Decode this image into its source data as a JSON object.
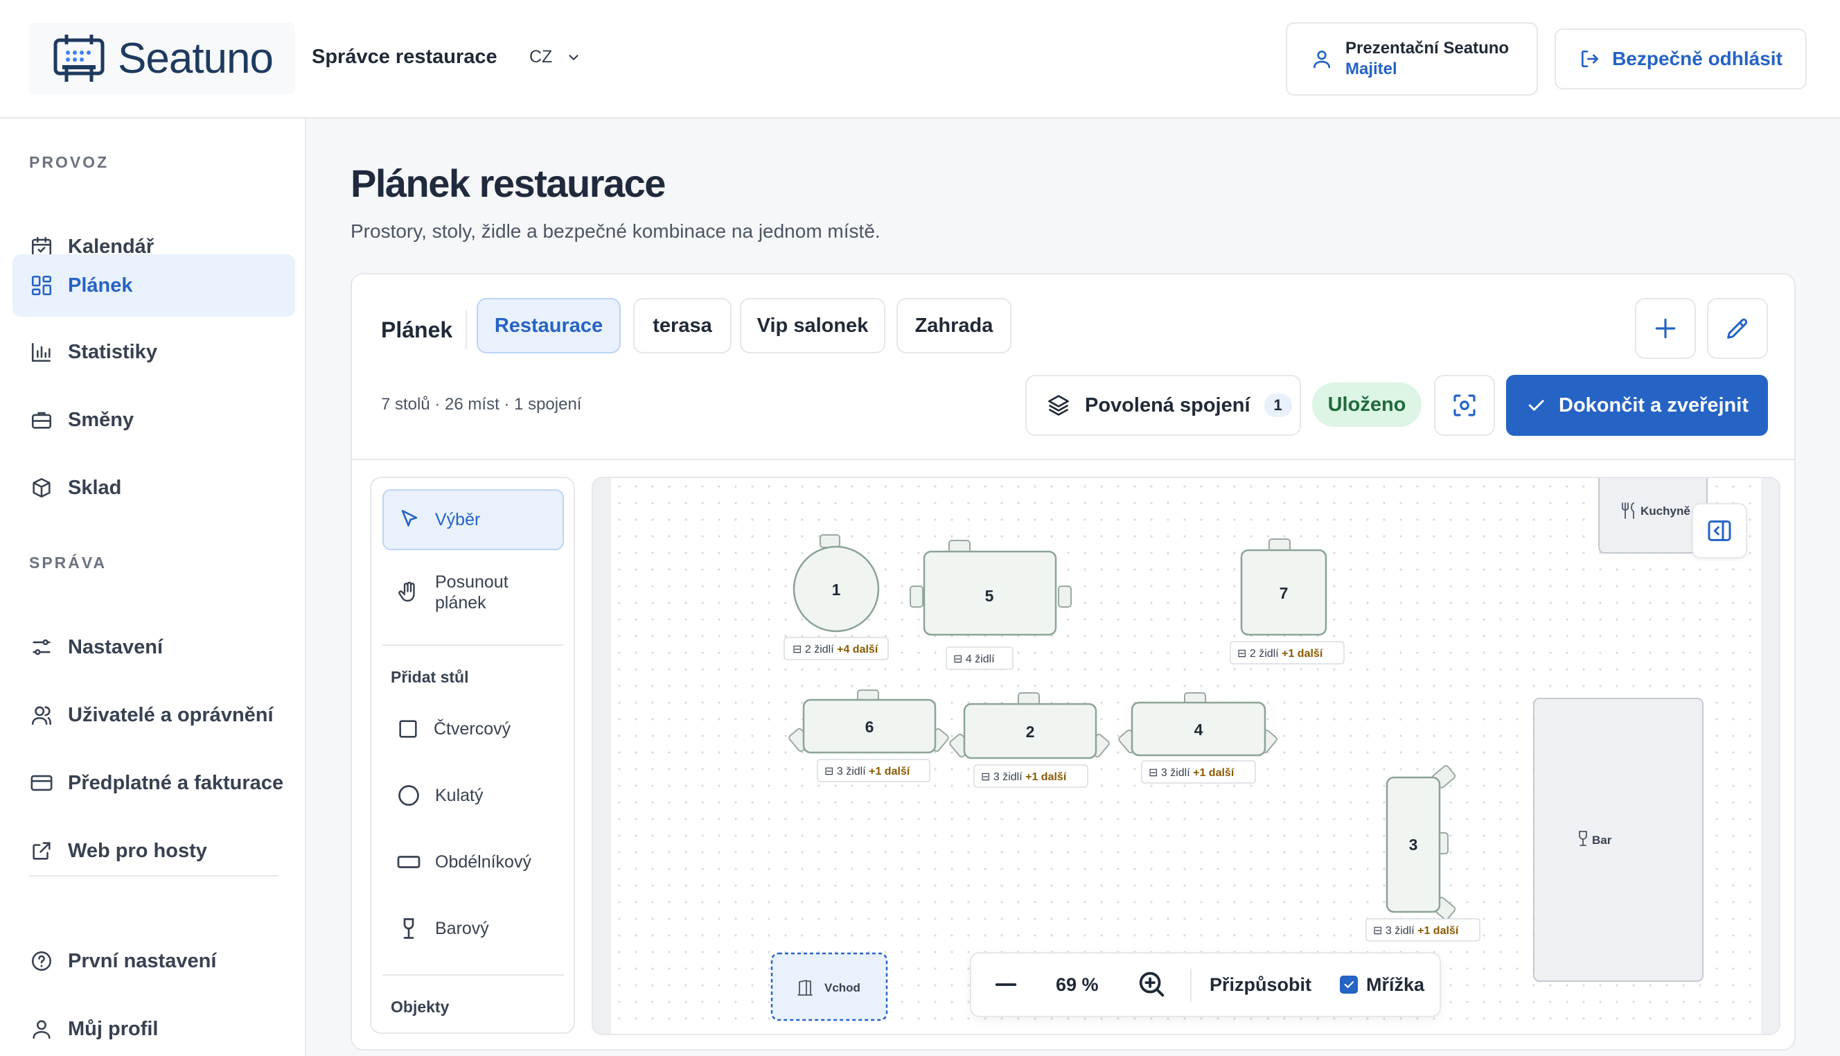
{
  "header": {
    "logo_text": "Seatuno",
    "app_title": "Správce restaurace",
    "language": "CZ",
    "user_name": "Prezentační Seatuno",
    "user_role": "Majitel",
    "logout_label": "Bezpečně odhlásit"
  },
  "sidebar": {
    "section_operations": "PROVOZ",
    "section_admin": "SPRÁVA",
    "items": [
      {
        "label": "Kalendář",
        "icon": "calendar-icon"
      },
      {
        "label": "Plánek",
        "icon": "layout-grid-icon"
      },
      {
        "label": "Statistiky",
        "icon": "bar-chart-icon"
      },
      {
        "label": "Směny",
        "icon": "briefcase-icon"
      },
      {
        "label": "Sklad",
        "icon": "box-icon"
      },
      {
        "label": "Nastavení",
        "icon": "sliders-icon"
      },
      {
        "label": "Uživatelé a oprávnění",
        "icon": "users-icon"
      },
      {
        "label": "Předplatné a fakturace",
        "icon": "credit-card-icon"
      },
      {
        "label": "Web pro hosty",
        "icon": "external-link-icon"
      },
      {
        "label": "První nastavení",
        "icon": "help-circle-icon"
      },
      {
        "label": "Můj profil",
        "icon": "user-icon"
      }
    ],
    "active_item": "Plánek"
  },
  "main": {
    "title": "Plánek restaurace",
    "subtitle": "Prostory, stoly, židle a bezpečné kombinace na jednom místě."
  },
  "planner": {
    "label": "Plánek",
    "tabs": [
      "Restaurace",
      "terasa",
      "Vip salonek",
      "Zahrada"
    ],
    "active_tab": "Restaurace",
    "stats": "7 stolů · 26 míst · 1 spojení",
    "joins_label": "Povolená spojení",
    "joins_count": "1",
    "saved_label": "Uloženo",
    "publish_label": "Dokončit a zveřejnit"
  },
  "tools": {
    "select": "Výběr",
    "pan": "Posunout plánek",
    "add_table_heading": "Přidat stůl",
    "table_types": [
      "Čtvercový",
      "Kulatý",
      "Obdélníkový",
      "Barový"
    ],
    "objects_heading": "Objekty"
  },
  "canvas": {
    "objects": {
      "kitchen": "Kuchyně",
      "bar": "Bar",
      "entrance": "Vchod"
    },
    "tables": [
      {
        "number": "1",
        "shape": "round",
        "chairs": "2 židlí",
        "extra": "+4 další"
      },
      {
        "number": "5",
        "shape": "rectangle",
        "chairs": "4 židlí",
        "extra": ""
      },
      {
        "number": "7",
        "shape": "square",
        "chairs": "2 židlí",
        "extra": "+1 další"
      },
      {
        "number": "6",
        "shape": "rectangle",
        "chairs": "3 židlí",
        "extra": "+1 další"
      },
      {
        "number": "2",
        "shape": "rectangle",
        "chairs": "3 židlí",
        "extra": "+1 další"
      },
      {
        "number": "4",
        "shape": "rectangle",
        "chairs": "3 židlí",
        "extra": "+1 další"
      },
      {
        "number": "3",
        "shape": "rectangle",
        "chairs": "3 židlí",
        "extra": "+1 další"
      }
    ]
  },
  "zoom": {
    "value": "69 %",
    "fit_label": "Přizpůsobit",
    "grid_label": "Mřížka",
    "grid_checked": true
  },
  "colors": {
    "accent": "#2563c4",
    "accent_light": "#e9f1fd",
    "saved_bg": "#dcf5e4",
    "table_fill": "#f1f5f2",
    "table_stroke": "#8aa496",
    "extra_text": "#8a5a00"
  }
}
